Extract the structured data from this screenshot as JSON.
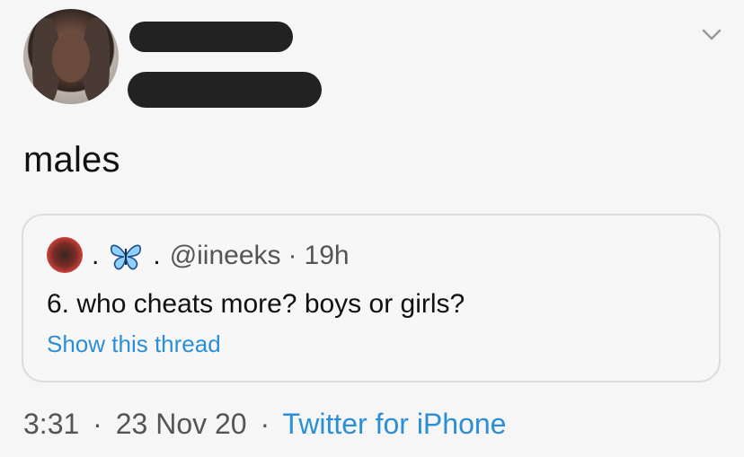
{
  "tweet": {
    "text": "males"
  },
  "quoted": {
    "name_dot_1": ".",
    "butterfly_emoji": "butterfly-icon",
    "name_dot_2": ".",
    "handle": "@iineeks",
    "separator": "·",
    "time": "19h",
    "text": "6. who cheats more? boys or girls?",
    "show_thread": "Show this thread"
  },
  "meta": {
    "time": "3:31",
    "sep1": "·",
    "date": "23 Nov 20",
    "sep2": "·",
    "source": "Twitter for iPhone"
  },
  "colors": {
    "link": "#2a8fd6",
    "redaction": "#222222"
  }
}
